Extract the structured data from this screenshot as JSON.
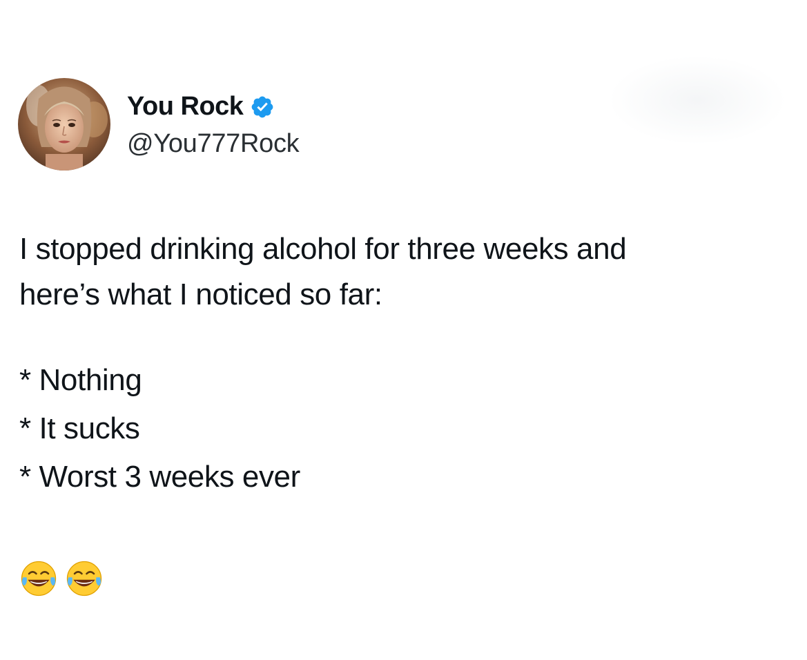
{
  "tweet": {
    "author": {
      "display_name": "You Rock",
      "handle": "@You777Rock",
      "verified": true,
      "verified_color": "#1d9bf0",
      "avatar_icon": "profile-photo"
    },
    "text": {
      "lines": [
        "I stopped drinking alcohol for three weeks and",
        "here’s what I noticed so far:"
      ],
      "bullets": [
        "* Nothing",
        "* It sucks",
        "* Worst 3 weeks ever"
      ]
    },
    "emojis": [
      "face-with-tears-of-joy",
      "face-with-tears-of-joy"
    ]
  }
}
